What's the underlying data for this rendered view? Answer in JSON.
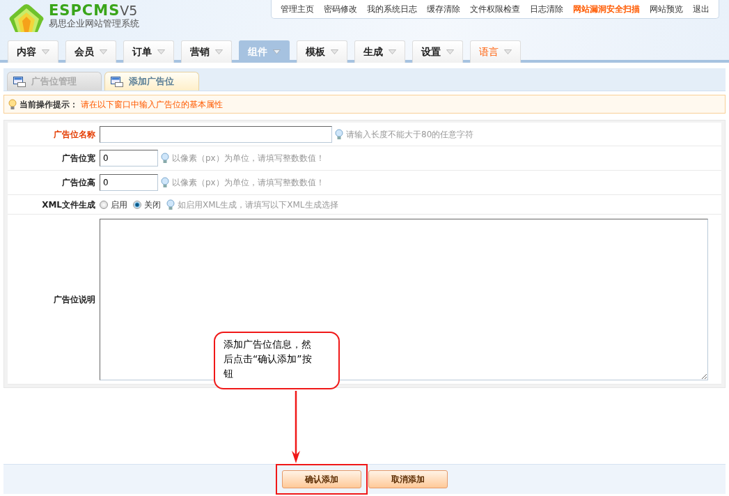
{
  "logo": {
    "brand": "ESPCMS",
    "version": "V5",
    "subtitle": "易思企业网站管理系统"
  },
  "top_links": [
    {
      "label": "管理主页",
      "highlight": false
    },
    {
      "label": "密码修改",
      "highlight": false
    },
    {
      "label": "我的系统日志",
      "highlight": false
    },
    {
      "label": "缓存清除",
      "highlight": false
    },
    {
      "label": "文件权限检查",
      "highlight": false
    },
    {
      "label": "日志清除",
      "highlight": false
    },
    {
      "label": "网站漏洞安全扫描",
      "highlight": true
    },
    {
      "label": "网站预览",
      "highlight": false
    },
    {
      "label": "退出",
      "highlight": false
    }
  ],
  "main_nav": [
    {
      "label": "内容",
      "selected": false,
      "highlight": false
    },
    {
      "label": "会员",
      "selected": false,
      "highlight": false
    },
    {
      "label": "订单",
      "selected": false,
      "highlight": false
    },
    {
      "label": "营销",
      "selected": false,
      "highlight": false
    },
    {
      "label": "组件",
      "selected": true,
      "highlight": false
    },
    {
      "label": "模板",
      "selected": false,
      "highlight": false
    },
    {
      "label": "生成",
      "selected": false,
      "highlight": false
    },
    {
      "label": "设置",
      "selected": false,
      "highlight": false
    },
    {
      "label": "语言",
      "selected": false,
      "highlight": true
    }
  ],
  "tabs": [
    {
      "label": "广告位管理",
      "selected": false
    },
    {
      "label": "添加广告位",
      "selected": true
    }
  ],
  "tip": {
    "label": "当前操作提示：",
    "text": "请在以下窗口中输入广告位的基本属性"
  },
  "form": {
    "rows": [
      {
        "kind": "text",
        "label": "广告位名称",
        "required": true,
        "hint": "请输入长度不能大于80的任意字符"
      },
      {
        "kind": "number",
        "label": "广告位宽",
        "required": false,
        "value": "0",
        "hint": "以像素（px）为单位，请填写整数数值！"
      },
      {
        "kind": "number",
        "label": "广告位高",
        "required": false,
        "value": "0",
        "hint": "以像素（px）为单位，请填写整数数值！"
      },
      {
        "kind": "radio",
        "label": "XML文件生成",
        "required": false,
        "options": [
          {
            "label": "启用",
            "selected": false
          },
          {
            "label": "关闭",
            "selected": true
          }
        ],
        "hint": "如启用XML生成，请填写以下XML生成选择"
      },
      {
        "kind": "textarea",
        "label": "广告位说明",
        "required": false
      }
    ]
  },
  "buttons": [
    {
      "label": "确认添加",
      "highlighted": true
    },
    {
      "label": "取消添加",
      "highlighted": false
    }
  ],
  "annotation": {
    "text": "添加广告位信息，然后点击“确认添加”按钮"
  }
}
